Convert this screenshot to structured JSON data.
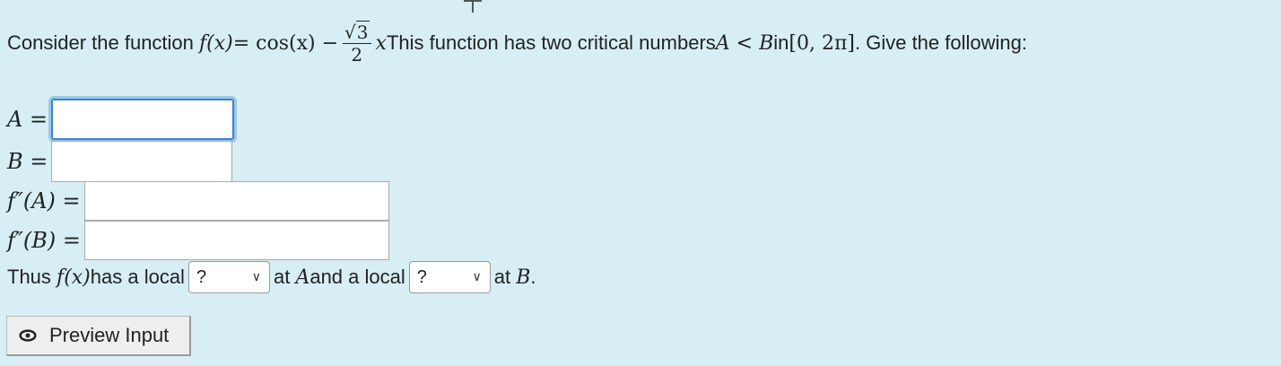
{
  "question": {
    "intro": "Consider the function",
    "f_lhs": "f(x)",
    "equals": " = cos(x) − ",
    "sqrt_num": "3",
    "den": "2",
    "x_var": "x",
    "middle": " This function has two critical numbers ",
    "ineq": "A < B",
    "in_word": " in ",
    "interval": "[0, 2π]",
    "tail": ". Give the following:"
  },
  "fields": {
    "a_label": "A =",
    "a_value": "",
    "b_label": "B =",
    "b_value": "",
    "fpa_label": "f″(A) =",
    "fpa_value": "",
    "fpb_label": "f″(B) =",
    "fpb_value": ""
  },
  "conclusion": {
    "thus": "Thus",
    "fx": "f(x)",
    "has_local": " has a local",
    "at_a": "at",
    "a_var": "A",
    "and_local": " and a local",
    "at_b": "at",
    "b_var": "B",
    "period": ".",
    "select_a": "?",
    "select_b": "?"
  },
  "preview": {
    "label": "Preview Input",
    "icon": "eye-icon"
  }
}
